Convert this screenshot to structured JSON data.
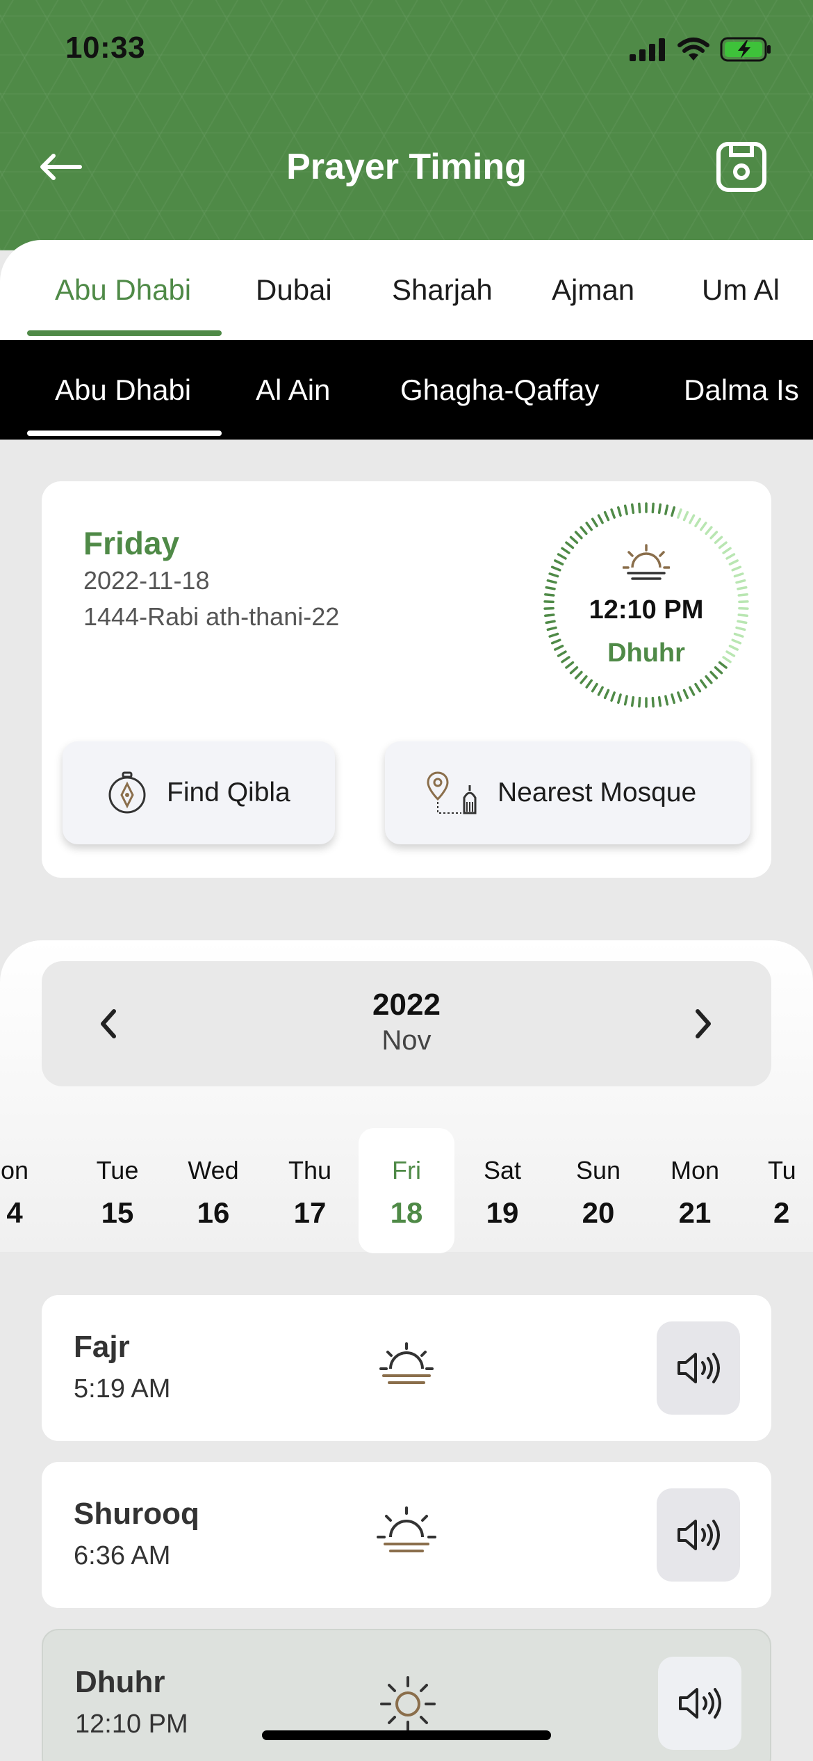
{
  "status_bar": {
    "time": "10:33"
  },
  "header": {
    "title": "Prayer Timing"
  },
  "city_tabs": [
    "Abu Dhabi",
    "Dubai",
    "Sharjah",
    "Ajman",
    "Um Al"
  ],
  "area_tabs": [
    "Abu Dhabi",
    "Al Ain",
    "Ghagha-Qaffay",
    "Dalma Is"
  ],
  "date_card": {
    "day": "Friday",
    "gregorian": "2022-11-18",
    "hijri": "1444-Rabi ath-thani-22",
    "next_prayer_time": "12:10 PM",
    "next_prayer_name": "Dhuhr",
    "qibla_label": "Find Qibla",
    "mosque_label": "Nearest Mosque"
  },
  "calendar": {
    "year": "2022",
    "month": "Nov",
    "days": [
      {
        "dow": "on",
        "num": "4"
      },
      {
        "dow": "Tue",
        "num": "15"
      },
      {
        "dow": "Wed",
        "num": "16"
      },
      {
        "dow": "Thu",
        "num": "17"
      },
      {
        "dow": "Fri",
        "num": "18"
      },
      {
        "dow": "Sat",
        "num": "19"
      },
      {
        "dow": "Sun",
        "num": "20"
      },
      {
        "dow": "Mon",
        "num": "21"
      },
      {
        "dow": "Tu",
        "num": "2"
      }
    ]
  },
  "prayers": [
    {
      "name": "Fajr",
      "time": "5:19 AM"
    },
    {
      "name": "Shurooq",
      "time": "6:36 AM"
    },
    {
      "name": "Dhuhr",
      "time": "12:10 PM"
    }
  ],
  "colors": {
    "brand_green": "#4f8a47",
    "icon_brown": "#8a6e4b"
  }
}
